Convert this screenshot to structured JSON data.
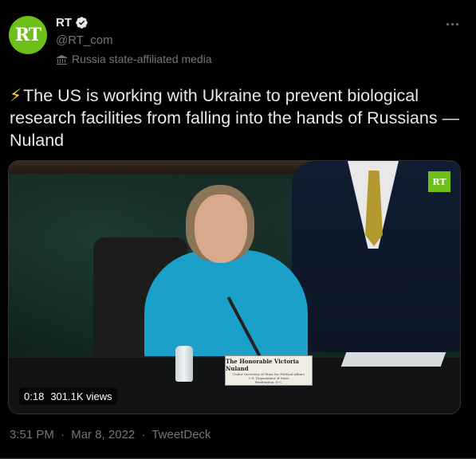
{
  "account": {
    "display_name": "RT",
    "handle": "@RT_com",
    "avatar_text": "RT",
    "label": "Russia state-affiliated media",
    "verified": true
  },
  "tweet": {
    "emoji": "⚡",
    "text": "The US is working with Ukraine to prevent biological research facilities from falling into the hands of Russians — Nuland"
  },
  "video": {
    "watermark": "RT",
    "duration": "0:18",
    "views": "301.1K views",
    "nameplate_name": "The Honorable Victoria Nuland",
    "nameplate_sub_1": "Under Secretary of State for Political Affairs",
    "nameplate_sub_2": "U.S. Department of State",
    "nameplate_sub_3": "Washington, D.C."
  },
  "meta": {
    "time": "3:51 PM",
    "date": "Mar 8, 2022",
    "source": "TweetDeck",
    "separator": "·"
  },
  "colors": {
    "background": "#000000",
    "text": "#e7e9ea",
    "secondary": "#71767b",
    "rt_green": "#6fbf1a",
    "verified_blue": "#1d9bf0"
  },
  "icons": {
    "verified": "verified-badge-icon",
    "affiliation": "state-media-flag-icon",
    "more": "more-options-icon"
  }
}
